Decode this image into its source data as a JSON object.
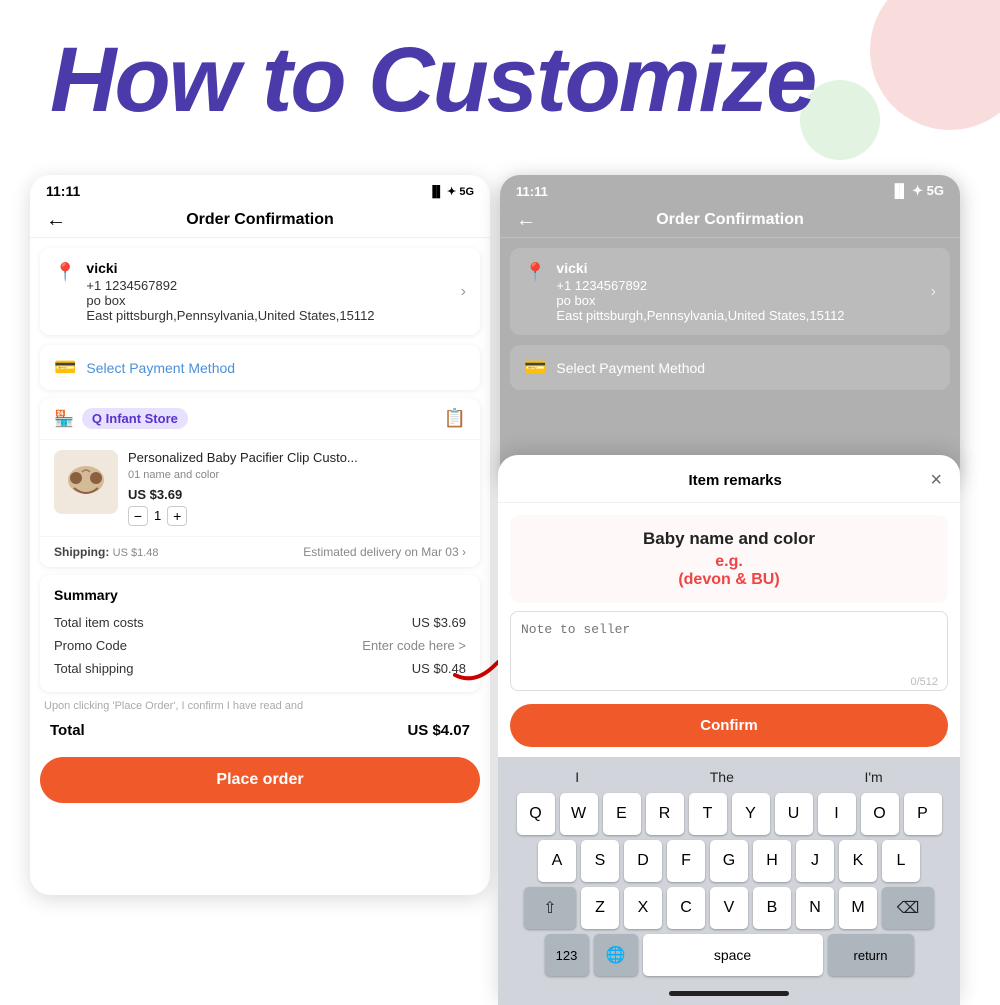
{
  "page": {
    "title": "How to Customize",
    "bg_circle_colors": [
      "#f5c5c5",
      "#c5e8c5"
    ]
  },
  "left_phone": {
    "status_time": "11:11",
    "status_signal": "▐▌▌",
    "nav_title": "Order Confirmation",
    "address": {
      "name": "vicki",
      "phone": "+1 1234567892",
      "line1": "po box",
      "line2": "East pittsburgh,Pennsylvania,United States,15112"
    },
    "payment": {
      "label": "Select Payment Method"
    },
    "store": {
      "name": "Q Infant Store"
    },
    "product": {
      "name": "Personalized Baby Pacifier Clip Custo...",
      "variant": "01 name and color",
      "price": "US $3.69",
      "quantity": "1"
    },
    "shipping": {
      "label": "Shipping:",
      "cost": "US $1.48",
      "estimated": "Estimated delivery on Mar 03"
    },
    "summary": {
      "title": "Summary",
      "total_items_label": "Total item costs",
      "total_items_value": "US $3.69",
      "promo_label": "Promo Code",
      "promo_value": "Enter code here >",
      "shipping_label": "Total shipping",
      "shipping_value": "US $0.48"
    },
    "disclaimer": "Upon clicking 'Place Order', I confirm I have read and",
    "total_label": "Total",
    "total_value": "US $4.07",
    "place_order": "Place order"
  },
  "right_phone": {
    "status_time": "11:11",
    "nav_title": "Order Confirmation",
    "address": {
      "name": "vicki",
      "phone": "+1 1234567892",
      "line1": "po box",
      "line2": "East pittsburgh,Pennsylvania,United States,15112"
    },
    "payment": {
      "label": "Select Payment Method"
    }
  },
  "popup": {
    "title": "Item remarks",
    "close": "×",
    "instruction_title": "Baby name and color",
    "instruction_example": "e.g.\n(devon & BU)",
    "textarea_placeholder": "Note to seller",
    "char_count": "0/512",
    "confirm_label": "Confirm"
  },
  "keyboard": {
    "suggestions": [
      "I",
      "The",
      "I'm"
    ],
    "row1": [
      "Q",
      "W",
      "E",
      "R",
      "T",
      "Y",
      "U",
      "I",
      "O",
      "P"
    ],
    "row2": [
      "A",
      "S",
      "D",
      "F",
      "G",
      "H",
      "J",
      "K",
      "L"
    ],
    "row3": [
      "Z",
      "X",
      "C",
      "V",
      "B",
      "N",
      "M"
    ],
    "space_label": "space",
    "return_label": "return",
    "num_label": "123"
  }
}
